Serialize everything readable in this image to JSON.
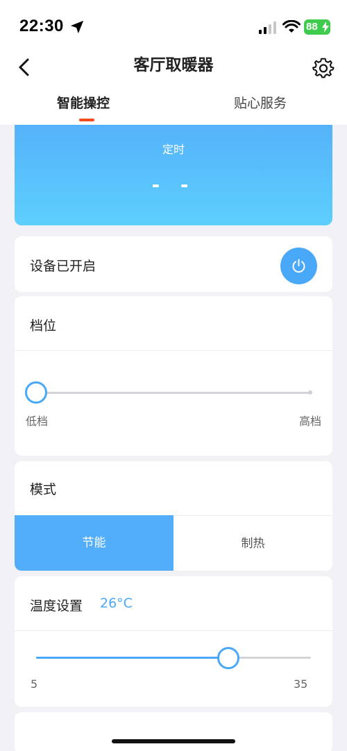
{
  "status_bar": {
    "time": "22:30",
    "battery": "88"
  },
  "header": {
    "title": "客厅取暖器"
  },
  "tabs": [
    {
      "label": "智能操控",
      "active": true
    },
    {
      "label": "贴心服务",
      "active": false
    }
  ],
  "timer": {
    "label": "定时",
    "value": "- -"
  },
  "power": {
    "label": "设备已开启",
    "on": true
  },
  "gear": {
    "title": "档位",
    "min_label": "低档",
    "max_label": "高档",
    "level": 0
  },
  "mode": {
    "title": "模式",
    "options": [
      "节能",
      "制热"
    ],
    "selected": "节能"
  },
  "temperature": {
    "title": "温度设置",
    "value": "26°C",
    "current": 26,
    "min": 5,
    "max": 35,
    "min_label": "5",
    "max_label": "35"
  },
  "colors": {
    "accent": "#4aa8f8",
    "tab_indicator": "#f24a1a",
    "timer_gradient_top": "#55b2fa",
    "timer_gradient_bottom": "#5dcffd",
    "battery": "#3fcb4e"
  },
  "icons": [
    "location-arrow-icon",
    "cellular-signal-icon",
    "wifi-icon",
    "battery-icon",
    "back-chevron-icon",
    "gear-icon",
    "power-icon"
  ]
}
